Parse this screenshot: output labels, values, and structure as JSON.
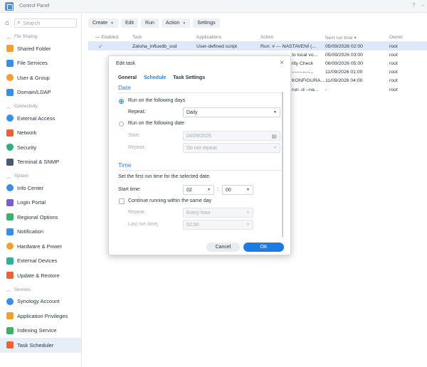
{
  "window": {
    "title": "Control Panel",
    "controls": [
      "?",
      "–"
    ]
  },
  "sidebar": {
    "search_placeholder": "Search",
    "sections": [
      {
        "title": "File Sharing",
        "items": [
          "Shared Folder",
          "File Services",
          "User & Group",
          "Domain/LDAP"
        ]
      },
      {
        "title": "Connectivity",
        "items": [
          "External Access",
          "Network",
          "Security",
          "Terminal & SNMP"
        ]
      },
      {
        "title": "System",
        "items": [
          "Info Center",
          "Login Portal",
          "Regional Options",
          "Notification",
          "Hardware & Power",
          "External Devices",
          "Update & Restore"
        ]
      },
      {
        "title": "Services",
        "items": [
          "Synology Account",
          "Application Privileges",
          "Indexing Service",
          "Task Scheduler"
        ]
      }
    ],
    "active_item": "Task Scheduler"
  },
  "toolbar": {
    "create": "Create",
    "edit": "Edit",
    "run": "Run",
    "action": "Action",
    "settings": "Settings"
  },
  "table": {
    "headers": [
      "Enabled",
      "Task",
      "Applications",
      "Action",
      "Next run time",
      "Owner"
    ],
    "enabled_header_prefix": "—",
    "sort_indicator": "▾",
    "rows": [
      [
        "✓",
        "Zaloha_influxdb_ssd",
        "User-defined script",
        "Run: # --- NASTAVENÍ (...",
        "05/09/2026 02:00",
        "root"
      ],
      [
        "",
        "",
        "",
        "to local vo...",
        "05/09/2026 03:00",
        "root"
      ],
      [
        "",
        "",
        "",
        "rity Check",
        "06/09/2026 05:00",
        "root"
      ],
      [
        "",
        "",
        "",
        "-----------...",
        "11/09/2026 01:00",
        "root"
      ],
      [
        "",
        "",
        "",
        "KONFIGURA...",
        "11/09/2026 04:00",
        "root"
      ],
      [
        "",
        "",
        "",
        "run -d --na...",
        "-",
        "root"
      ]
    ]
  },
  "dialog": {
    "title": "Edit task",
    "tabs": [
      "General",
      "Schedule",
      "Task Settings"
    ],
    "active_tab": "Schedule",
    "date_section": "Date",
    "opt_days": "Run on the following days",
    "repeat_label": "Repeat:",
    "repeat_value": "Daily",
    "opt_date": "Run on the following date",
    "start_label": "Start:",
    "start_value": "04/09/2026",
    "repeat2_label": "Repeat:",
    "repeat2_value": "Do not repeat",
    "time_section": "Time",
    "time_hint": "Set the first run time for the selected date.",
    "start_time_label": "Start time:",
    "hour": "02",
    "colon": ":",
    "minute": "00",
    "continue_label": "Continue running within the same day",
    "repeat3_label": "Repeat:",
    "repeat3_value": "Every hour",
    "last_run_label": "Last run time:",
    "last_run_value": "02:00",
    "cancel": "Cancel",
    "ok": "OK"
  }
}
